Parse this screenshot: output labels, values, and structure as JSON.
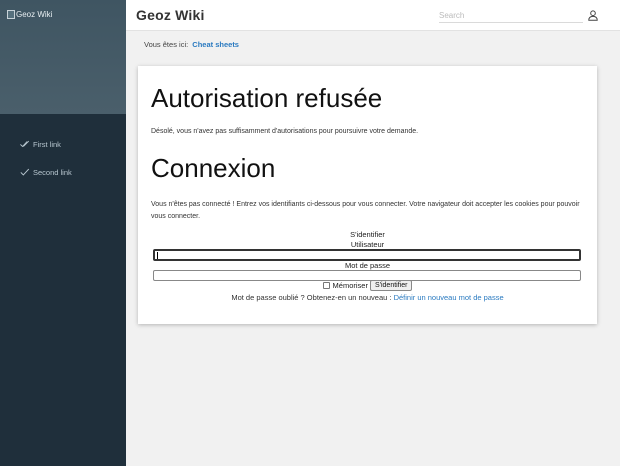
{
  "sidebar": {
    "logo_alt": "Geoz Wiki",
    "links": [
      {
        "label": "First link",
        "icon": "double-check-icon"
      },
      {
        "label": "Second link",
        "icon": "check-icon"
      }
    ]
  },
  "header": {
    "title": "Geoz Wiki",
    "search_placeholder": "Search"
  },
  "breadcrumb": {
    "prefix": "Vous êtes ici:",
    "link": "Cheat sheets"
  },
  "main": {
    "title": "Autorisation refusée",
    "denied_text": "Désolé, vous n'avez pas suffisamment d'autorisations pour poursuivre votre demande.",
    "login_title": "Connexion",
    "login_text": "Vous n'êtes pas connecté ! Entrez vos identifiants ci-dessous pour vous connecter. Votre navigateur doit accepter les cookies pour pouvoir vous connecter.",
    "form": {
      "legend": "S'identifier",
      "user_label": "Utilisateur",
      "user_value": "",
      "password_label": "Mot de passe",
      "password_value": "",
      "remember_label": "Mémoriser",
      "remember_checked": false,
      "submit_label": "S'identifier"
    },
    "forgot_text": "Mot de passe oublié ? Obtenez-en un nouveau :",
    "forgot_link": "Définir un nouveau mot de passe"
  },
  "colors": {
    "sidebar_bg": "#1f2f3b",
    "sidebar_logo_bg": "#4a5f6b",
    "link": "#2a7ac0",
    "page_bg": "#f1f1f1"
  }
}
